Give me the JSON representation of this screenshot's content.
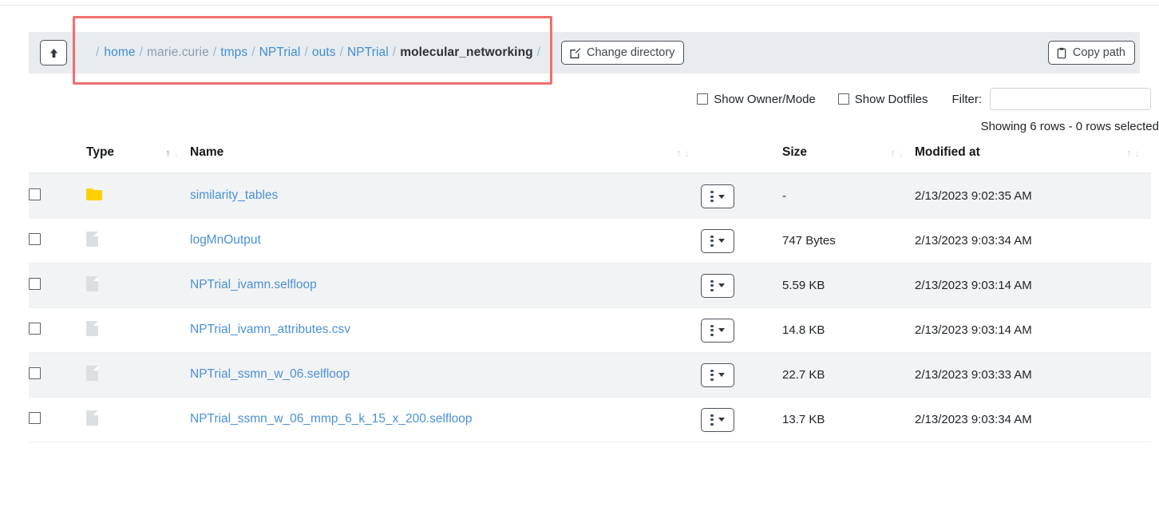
{
  "toolbar": {
    "up_button_icon": "arrow-up-icon",
    "up_button_label": "↑",
    "change_directory_label": "Change directory",
    "change_directory_icon": "edit-square-icon",
    "copy_path_label": "Copy path",
    "copy_path_icon": "clipboard-icon",
    "breadcrumb": {
      "leading_separator": "/",
      "separator": "/",
      "trailing_separator": "/",
      "items": [
        {
          "label": "home",
          "style": "link"
        },
        {
          "label": "marie.curie",
          "style": "muted"
        },
        {
          "label": "tmps",
          "style": "link"
        },
        {
          "label": "NPTrial",
          "style": "link"
        },
        {
          "label": "outs",
          "style": "link"
        },
        {
          "label": "NPTrial",
          "style": "link"
        },
        {
          "label": "molecular_networking",
          "style": "current"
        }
      ]
    }
  },
  "filters": {
    "show_owner_mode_label": "Show Owner/Mode",
    "show_owner_mode_checked": false,
    "show_dotfiles_label": "Show Dotfiles",
    "show_dotfiles_checked": false,
    "filter_label": "Filter:",
    "filter_value": "",
    "filter_placeholder": ""
  },
  "status": {
    "showing_text": "Showing 6 rows - 0 rows selected"
  },
  "table": {
    "columns": [
      {
        "key": "checkbox",
        "label": "",
        "sortable": false
      },
      {
        "key": "type",
        "label": "Type",
        "sortable": true,
        "sort_state": "asc"
      },
      {
        "key": "name",
        "label": "Name",
        "sortable": true,
        "sort_state": "none"
      },
      {
        "key": "actions",
        "label": "",
        "sortable": false
      },
      {
        "key": "size",
        "label": "Size",
        "sortable": true,
        "sort_state": "none"
      },
      {
        "key": "modified",
        "label": "Modified at",
        "sortable": true,
        "sort_state": "none"
      }
    ],
    "sort_icons": {
      "asc": "↑",
      "desc": "↓"
    },
    "action_button": {
      "dots_icon": "kebab-menu-icon",
      "caret_icon": "caret-down-icon"
    },
    "rows": [
      {
        "selected": false,
        "kind": "folder",
        "type_icon": "folder-icon",
        "name": "similarity_tables",
        "size": "-",
        "modified": "2/13/2023 9:02:35 AM"
      },
      {
        "selected": false,
        "kind": "file",
        "type_icon": "file-icon",
        "name": "logMnOutput",
        "size": "747 Bytes",
        "modified": "2/13/2023 9:03:34 AM"
      },
      {
        "selected": false,
        "kind": "file",
        "type_icon": "file-icon",
        "name": "NPTrial_ivamn.selfloop",
        "size": "5.59 KB",
        "modified": "2/13/2023 9:03:14 AM"
      },
      {
        "selected": false,
        "kind": "file",
        "type_icon": "file-icon",
        "name": "NPTrial_ivamn_attributes.csv",
        "size": "14.8 KB",
        "modified": "2/13/2023 9:03:14 AM"
      },
      {
        "selected": false,
        "kind": "file",
        "type_icon": "file-icon",
        "name": "NPTrial_ssmn_w_06.selfloop",
        "size": "22.7 KB",
        "modified": "2/13/2023 9:03:33 AM"
      },
      {
        "selected": false,
        "kind": "file",
        "type_icon": "file-icon",
        "name": "NPTrial_ssmn_w_06_mmp_6_k_15_x_200.selfloop",
        "size": "13.7 KB",
        "modified": "2/13/2023 9:03:34 AM"
      }
    ]
  },
  "annotation": {
    "color": "#f0706e",
    "target": "breadcrumb-path"
  },
  "colors": {
    "toolbar_bg": "#e9ecef",
    "link": "#4a90d9",
    "folder": "#ffd100",
    "row_alt_bg": "#f2f3f4",
    "annotation": "#f0706e"
  }
}
